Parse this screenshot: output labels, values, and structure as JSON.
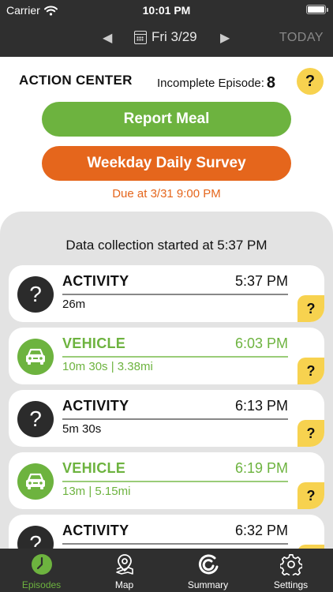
{
  "status_bar": {
    "carrier": "Carrier",
    "time": "10:01 PM"
  },
  "date_nav": {
    "date": "Fri 3/29",
    "today_label": "TODAY"
  },
  "action_center": {
    "title": "ACTION CENTER",
    "incomplete_label": "Incomplete Episode:",
    "incomplete_count": "8",
    "help": "?",
    "report_meal_label": "Report Meal",
    "survey_label": "Weekday Daily Survey",
    "due_text": "Due at 3/31 9:00 PM"
  },
  "episodes": {
    "collection_text": "Data collection started at 5:37 PM",
    "items": [
      {
        "type": "ACTIVITY",
        "time": "5:37 PM",
        "detail": "26m",
        "icon": "question-icon",
        "flag": "?"
      },
      {
        "type": "VEHICLE",
        "time": "6:03 PM",
        "detail": "10m 30s | 3.38mi",
        "icon": "car-icon",
        "flag": "?"
      },
      {
        "type": "ACTIVITY",
        "time": "6:13 PM",
        "detail": "5m 30s",
        "icon": "question-icon",
        "flag": "?"
      },
      {
        "type": "VEHICLE",
        "time": "6:19 PM",
        "detail": "13m | 5.15mi",
        "icon": "car-icon",
        "flag": "?"
      },
      {
        "type": "ACTIVITY",
        "time": "6:32 PM",
        "detail": "",
        "icon": "question-icon",
        "flag": "?"
      }
    ]
  },
  "tabs": [
    {
      "label": "Episodes",
      "icon": "clock-icon",
      "active": true
    },
    {
      "label": "Map",
      "icon": "map-pin-icon",
      "active": false
    },
    {
      "label": "Summary",
      "icon": "summary-icon",
      "active": false
    },
    {
      "label": "Settings",
      "icon": "gear-icon",
      "active": false
    }
  ],
  "colors": {
    "green": "#6db33f",
    "orange": "#e5661c",
    "yellow": "#f7d24f",
    "dark": "#2f2f2f"
  }
}
